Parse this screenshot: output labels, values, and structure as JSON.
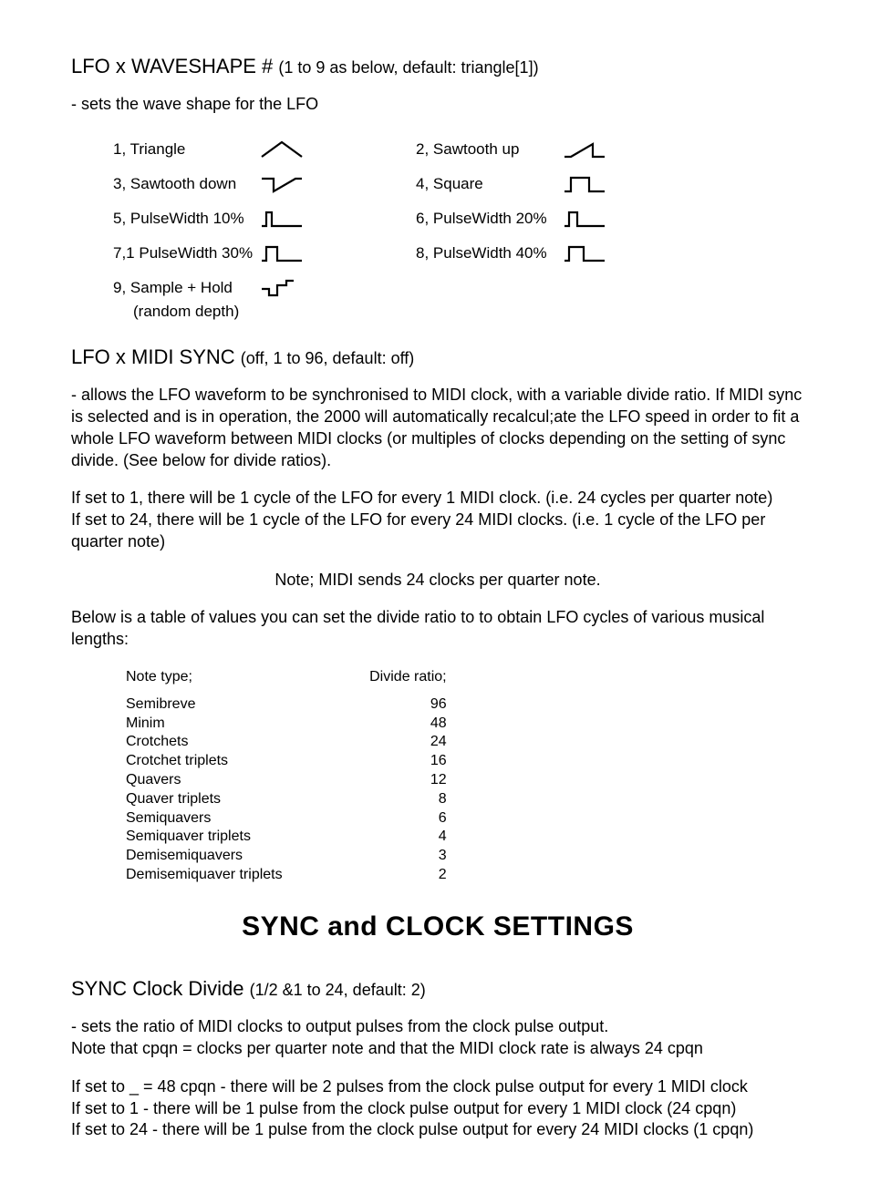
{
  "lfo_waveshape": {
    "heading_main": "LFO  x WAVESHAPE # ",
    "heading_range": "(1 to 9 as below, default: triangle[1])",
    "desc": "- sets the wave shape for the LFO",
    "items": [
      {
        "label": "1, Triangle"
      },
      {
        "label": "2, Sawtooth up"
      },
      {
        "label": "3, Sawtooth down"
      },
      {
        "label": "4, Square"
      },
      {
        "label": "5, PulseWidth 10%"
      },
      {
        "label": "6, PulseWidth 20%"
      },
      {
        "label": "7,1 PulseWidth 30%"
      },
      {
        "label": "8, PulseWidth 40%"
      },
      {
        "label": "9, Sample + Hold"
      }
    ],
    "item9_sub": "(random depth)"
  },
  "lfo_midisync": {
    "heading_main": "LFO  x MIDI SYNC ",
    "heading_range": "(off, 1 to 96, default: off)",
    "p1": "- allows the LFO waveform to be synchronised to MIDI clock, with a variable divide ratio. If MIDI sync is selected and is in operation, the 2000 will automatically recalcul;ate the LFO speed in order to fit a whole LFO waveform between MIDI clocks (or multiples of clocks depending on the setting of sync divide. (See below for divide ratios).",
    "p2a": "If set to 1, there will be 1 cycle of the LFO for every 1 MIDI clock. (i.e. 24 cycles per quarter note)",
    "p2b": "If set to 24, there will be 1 cycle of the LFO for every 24 MIDI clocks. (i.e. 1 cycle of the LFO per quarter note)",
    "note": "Note; MIDI sends 24 clocks per quarter note.",
    "table_intro": "Below is a table of values you can set the divide ratio to to obtain LFO cycles of various musical lengths:",
    "table_h1": "Note type;",
    "table_h2": "Divide ratio;",
    "table_rows": [
      {
        "name": "Semibreve",
        "ratio": "96"
      },
      {
        "name": "Minim",
        "ratio": "48"
      },
      {
        "name": "Crotchets",
        "ratio": "24"
      },
      {
        "name": "Crotchet triplets",
        "ratio": "16"
      },
      {
        "name": "Quavers",
        "ratio": "12"
      },
      {
        "name": "Quaver triplets",
        "ratio": "8"
      },
      {
        "name": "Semiquavers",
        "ratio": "6"
      },
      {
        "name": "Semiquaver triplets",
        "ratio": "4"
      },
      {
        "name": "Demisemiquavers",
        "ratio": "3"
      },
      {
        "name": "Demisemiquaver triplets",
        "ratio": "2"
      }
    ]
  },
  "sync_settings": {
    "title": "SYNC and CLOCK SETTINGS",
    "heading_main": "SYNC  Clock Divide ",
    "heading_range": "(1/2 &1 to 24, default: 2)",
    "p1a": "- sets the ratio of MIDI clocks to output pulses from the clock pulse output.",
    "p1b": "Note that cpqn = clocks per quarter note and that the MIDI clock rate is always 24 cpqn",
    "p2a": "If set to _ = 48 cpqn - there will be 2 pulses from the clock pulse output for every 1 MIDI clock",
    "p2b": "If set to 1 - there will be 1 pulse from the clock pulse output for every 1 MIDI clock (24 cpqn)",
    "p2c": "If set to 24 - there will be 1 pulse from the clock pulse output for every 24 MIDI clocks (1 cpqn)"
  }
}
